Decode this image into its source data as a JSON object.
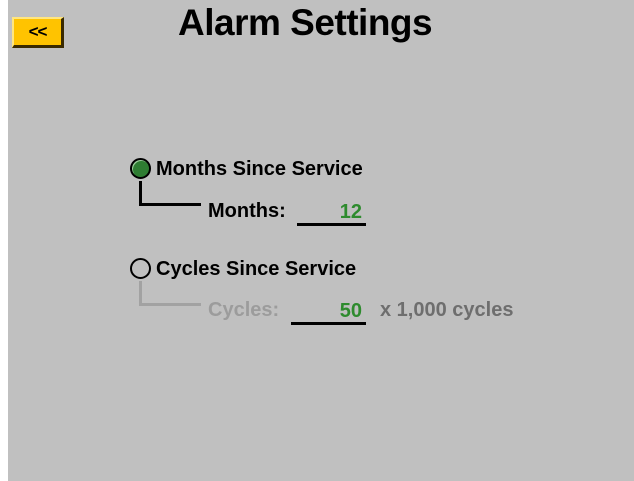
{
  "header": {
    "back_label": "<<",
    "title": "Alarm Settings"
  },
  "options": {
    "months": {
      "label": "Months Since Service",
      "selected": true,
      "field_label": "Months:",
      "value": "12"
    },
    "cycles": {
      "label": "Cycles Since Service",
      "selected": false,
      "field_label": "Cycles:",
      "value": "50",
      "units": "x 1,000 cycles"
    }
  },
  "colors": {
    "background": "#c0c0c0",
    "button": "#ffc300",
    "selected_radio": "#2e7d32",
    "value_text": "#2e8b2e",
    "disabled_text": "#9c9c9c"
  }
}
